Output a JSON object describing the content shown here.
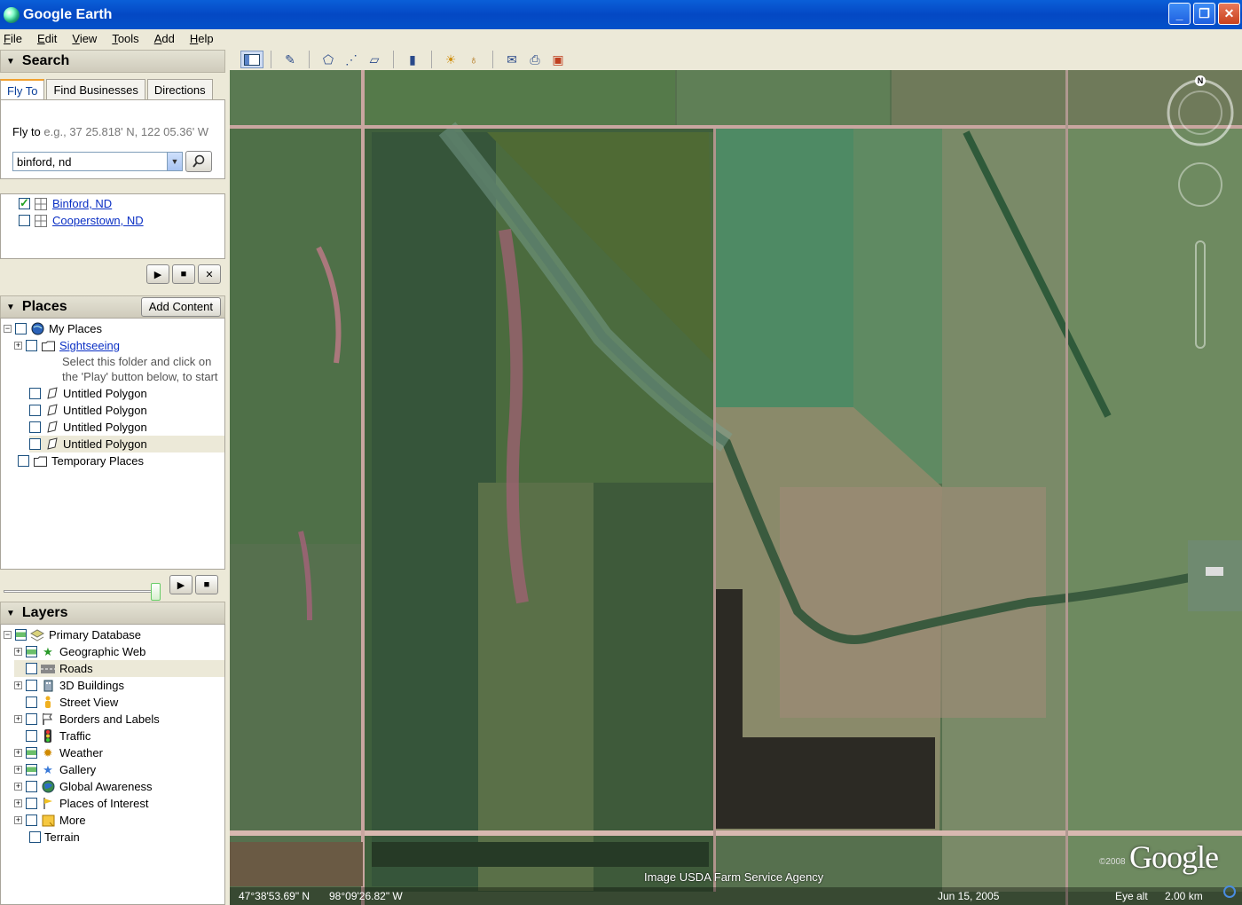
{
  "window": {
    "title": "Google Earth"
  },
  "menu": [
    "File",
    "Edit",
    "View",
    "Tools",
    "Add",
    "Help"
  ],
  "search": {
    "header": "Search",
    "tabs": [
      "Fly To",
      "Find Businesses",
      "Directions"
    ],
    "fly_label": "Fly to",
    "fly_hint": "e.g., 37 25.818' N, 122 05.36' W",
    "query": "binford, nd",
    "results": [
      {
        "label": "Binford, ND",
        "checked": true
      },
      {
        "label": "Cooperstown, ND",
        "checked": false
      }
    ]
  },
  "places": {
    "header": "Places",
    "add_content": "Add Content",
    "my_places": "My Places",
    "sightseeing": "Sightseeing",
    "sightseeing_desc_1": "Select this folder and click on",
    "sightseeing_desc_2": "the 'Play' button below, to start",
    "polygons": [
      "Untitled Polygon",
      "Untitled Polygon",
      "Untitled Polygon",
      "Untitled Polygon"
    ],
    "temporary": "Temporary Places"
  },
  "layers": {
    "header": "Layers",
    "root": "Primary Database",
    "items": [
      {
        "label": "Geographic Web",
        "icon": "star-green-icon",
        "state": "partial"
      },
      {
        "label": "Roads",
        "icon": "road-icon",
        "state": "off"
      },
      {
        "label": "3D Buildings",
        "icon": "building-icon",
        "state": "off"
      },
      {
        "label": "Street View",
        "icon": "person-icon",
        "state": "off"
      },
      {
        "label": "Borders and Labels",
        "icon": "flag-icon",
        "state": "off"
      },
      {
        "label": "Traffic",
        "icon": "traffic-light-icon",
        "state": "off"
      },
      {
        "label": "Weather",
        "icon": "sun-icon",
        "state": "partial"
      },
      {
        "label": "Gallery",
        "icon": "star-blue-icon",
        "state": "partial"
      },
      {
        "label": "Global Awareness",
        "icon": "globe-icon",
        "state": "off"
      },
      {
        "label": "Places of Interest",
        "icon": "pin-flag-icon",
        "state": "off"
      },
      {
        "label": "More",
        "icon": "folder-note-icon",
        "state": "off"
      }
    ],
    "terrain": "Terrain"
  },
  "viewer": {
    "credit": "Image USDA Farm Service Agency",
    "copyright": "©2008",
    "logo": "Google",
    "north": "N",
    "lat": "47°38'53.69\" N",
    "lon": "98°09'26.82\" W",
    "date": "Jun 15, 2005",
    "eye_alt_label": "Eye alt",
    "eye_alt": "2.00 km"
  }
}
